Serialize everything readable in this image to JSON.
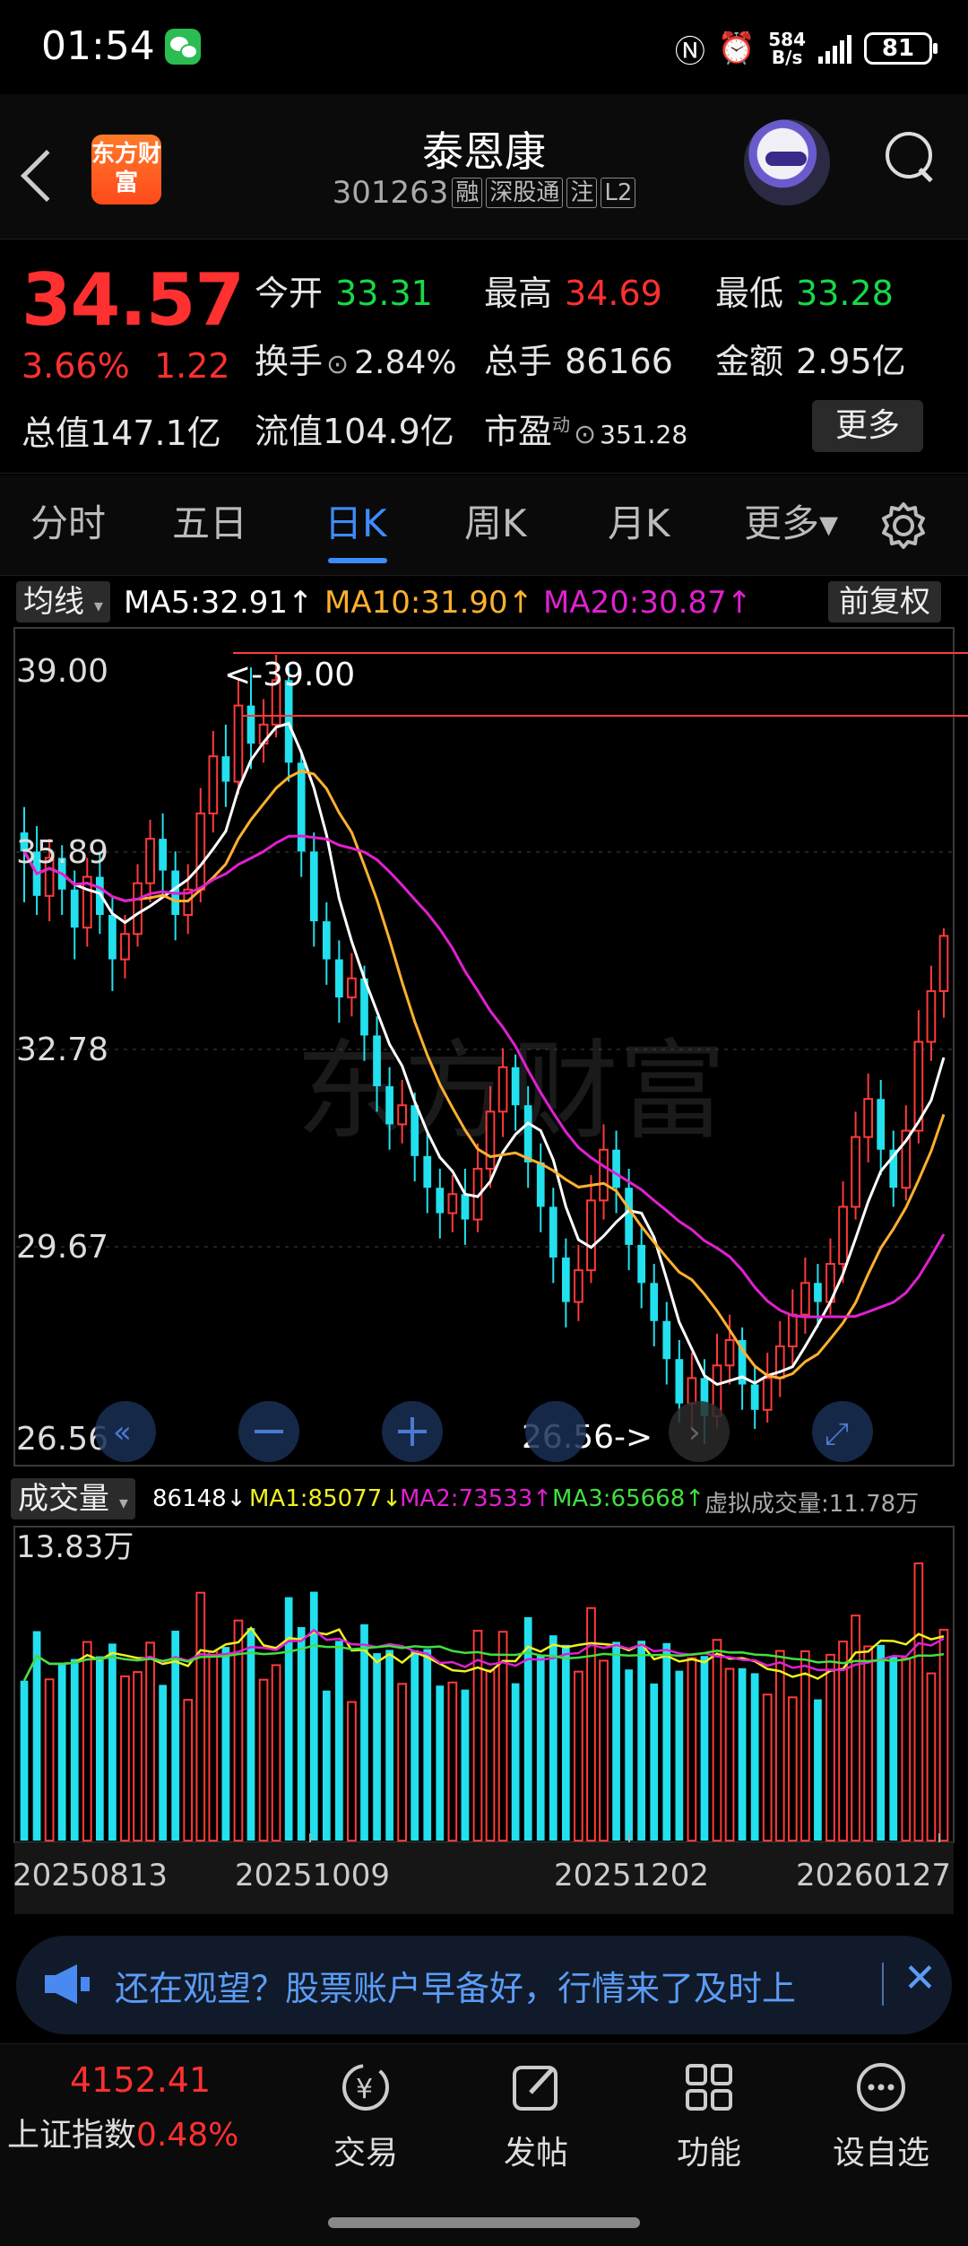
{
  "status": {
    "time": "01:54",
    "speed_top": "584",
    "speed_bottom": "B/s",
    "battery": "81"
  },
  "header": {
    "name": "泰恩康",
    "code": "301263",
    "tags": [
      "融",
      "深股通",
      "注",
      "L2"
    ],
    "app_logo": "东方财富"
  },
  "quote": {
    "price": "34.57",
    "pct": "3.66%",
    "change": "1.22",
    "open_label": "今开",
    "open": "33.31",
    "high_label": "最高",
    "high": "34.69",
    "low_label": "最低",
    "low": "33.28",
    "turnover_label": "换手",
    "turnover": "2.84%",
    "volume_label": "总手",
    "volume": "86166",
    "amount_label": "金额",
    "amount": "2.95亿",
    "total_cap": "总值147.1亿",
    "float_cap": "流值104.9亿",
    "pe_label": "市盈",
    "pe_sup": "动",
    "pe": "351.28",
    "more": "更多"
  },
  "tabs": [
    "分时",
    "五日",
    "日K",
    "周K",
    "月K",
    "更多▾"
  ],
  "active_tab": "日K",
  "kline": {
    "indicator_btn": "均线",
    "ma5": "MA5:32.91↑",
    "ma10": "MA10:31.90↑",
    "ma20": "MA20:30.87↑",
    "adjust_btn": "前复权",
    "y_labels": [
      "39.00",
      "35.89",
      "32.78",
      "29.67",
      "26.56"
    ],
    "max_marker": "<-39.00",
    "min_marker": "26.56->",
    "watermark": "东方财富",
    "colors": {
      "up": "#ff3a3a",
      "down": "#22e0ee",
      "ma5": "#ffffff",
      "ma10": "#ffb030",
      "ma20": "#e020d0"
    }
  },
  "volume": {
    "indicator_btn": "成交量",
    "vol": "86148↓",
    "ma1": "MA1:85077↓",
    "ma2": "MA2:73533↑",
    "ma3": "MA3:65668↑",
    "virtual": "虚拟成交量:11.78万",
    "max_label": "13.83万",
    "dates": [
      "20250813",
      "20251009",
      "20251202",
      "20260127"
    ]
  },
  "chart_data": {
    "type": "candlestick",
    "ylim": [
      26.56,
      39.0
    ],
    "candles": [
      [
        36.2,
        35.9,
        36.6,
        35.1
      ],
      [
        35.9,
        35.2,
        36.3,
        34.9
      ],
      [
        35.2,
        35.8,
        36.1,
        34.8
      ],
      [
        35.8,
        35.3,
        36.0,
        34.9
      ],
      [
        35.3,
        34.7,
        35.6,
        34.2
      ],
      [
        34.7,
        35.5,
        35.8,
        34.4
      ],
      [
        35.5,
        34.9,
        35.9,
        34.6
      ],
      [
        34.9,
        34.2,
        35.2,
        33.7
      ],
      [
        34.2,
        34.6,
        34.9,
        33.9
      ],
      [
        34.6,
        35.4,
        35.7,
        34.4
      ],
      [
        35.4,
        36.1,
        36.4,
        35.1
      ],
      [
        36.1,
        35.6,
        36.5,
        35.2
      ],
      [
        35.6,
        34.9,
        35.9,
        34.5
      ],
      [
        34.9,
        35.3,
        35.7,
        34.6
      ],
      [
        35.3,
        36.5,
        36.9,
        35.1
      ],
      [
        36.5,
        37.4,
        37.8,
        36.2
      ],
      [
        37.4,
        37.0,
        37.9,
        36.6
      ],
      [
        37.0,
        38.2,
        38.6,
        36.8
      ],
      [
        38.2,
        37.6,
        38.8,
        37.2
      ],
      [
        37.6,
        37.9,
        38.3,
        37.3
      ],
      [
        37.9,
        38.6,
        39.0,
        37.7
      ],
      [
        38.6,
        37.3,
        38.8,
        37.0
      ],
      [
        37.3,
        35.9,
        37.5,
        35.5
      ],
      [
        35.9,
        34.8,
        36.2,
        34.4
      ],
      [
        34.8,
        34.2,
        35.1,
        33.8
      ],
      [
        34.2,
        33.6,
        34.5,
        33.2
      ],
      [
        33.6,
        33.9,
        34.3,
        33.3
      ],
      [
        33.9,
        33.0,
        34.1,
        32.6
      ],
      [
        33.0,
        32.2,
        33.3,
        31.8
      ],
      [
        32.2,
        31.6,
        32.5,
        31.2
      ],
      [
        31.6,
        31.9,
        32.3,
        31.3
      ],
      [
        31.9,
        31.1,
        32.1,
        30.7
      ],
      [
        31.1,
        30.6,
        31.5,
        30.2
      ],
      [
        30.6,
        30.2,
        30.9,
        29.8
      ],
      [
        30.2,
        30.5,
        30.8,
        29.9
      ],
      [
        30.5,
        30.1,
        30.9,
        29.7
      ],
      [
        30.1,
        30.9,
        31.3,
        29.9
      ],
      [
        30.9,
        31.8,
        32.2,
        30.6
      ],
      [
        31.8,
        32.5,
        32.8,
        31.4
      ],
      [
        32.5,
        31.9,
        32.7,
        31.5
      ],
      [
        31.9,
        31.0,
        32.2,
        30.6
      ],
      [
        31.0,
        30.3,
        31.3,
        29.9
      ],
      [
        30.3,
        29.5,
        30.6,
        29.1
      ],
      [
        29.5,
        28.8,
        29.8,
        28.4
      ],
      [
        28.8,
        29.3,
        29.7,
        28.5
      ],
      [
        29.3,
        30.4,
        30.8,
        29.1
      ],
      [
        30.4,
        31.2,
        31.6,
        30.1
      ],
      [
        31.2,
        30.6,
        31.5,
        30.2
      ],
      [
        30.6,
        29.7,
        30.9,
        29.3
      ],
      [
        29.7,
        29.1,
        30.0,
        28.7
      ],
      [
        29.1,
        28.5,
        29.4,
        28.1
      ],
      [
        28.5,
        27.9,
        28.8,
        27.5
      ],
      [
        27.9,
        27.2,
        28.2,
        26.9
      ],
      [
        27.2,
        27.6,
        28.0,
        26.8
      ],
      [
        27.6,
        27.0,
        27.9,
        26.56
      ],
      [
        27.0,
        27.8,
        28.3,
        26.8
      ],
      [
        27.8,
        28.2,
        28.6,
        27.5
      ],
      [
        28.2,
        27.5,
        28.4,
        27.1
      ],
      [
        27.5,
        27.1,
        27.8,
        26.8
      ],
      [
        27.1,
        27.6,
        28.0,
        26.9
      ],
      [
        27.6,
        28.1,
        28.5,
        27.3
      ],
      [
        28.1,
        28.6,
        29.0,
        27.8
      ],
      [
        28.6,
        29.1,
        29.5,
        28.3
      ],
      [
        29.1,
        28.8,
        29.4,
        28.4
      ],
      [
        28.8,
        29.4,
        29.8,
        28.6
      ],
      [
        29.4,
        30.3,
        30.7,
        29.1
      ],
      [
        30.3,
        31.4,
        31.8,
        30.1
      ],
      [
        31.4,
        32.0,
        32.4,
        31.0
      ],
      [
        32.0,
        31.2,
        32.3,
        30.8
      ],
      [
        31.2,
        30.6,
        31.5,
        30.3
      ],
      [
        30.6,
        31.5,
        31.9,
        30.4
      ],
      [
        31.5,
        32.9,
        33.4,
        31.3
      ],
      [
        32.9,
        33.7,
        34.1,
        32.6
      ],
      [
        33.7,
        34.57,
        34.69,
        33.28
      ]
    ]
  }
}
